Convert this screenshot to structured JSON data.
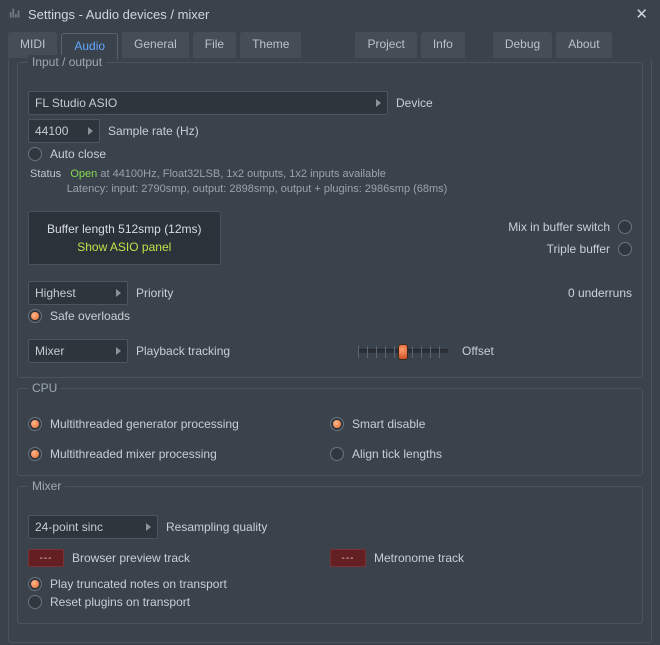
{
  "window": {
    "title": "Settings - Audio devices / mixer"
  },
  "tabs": {
    "midi": "MIDI",
    "audio": "Audio",
    "general": "General",
    "file": "File",
    "theme": "Theme",
    "project": "Project",
    "info": "Info",
    "debug": "Debug",
    "about": "About"
  },
  "io": {
    "legend": "Input / output",
    "device_value": "FL Studio ASIO",
    "device_label": "Device",
    "sample_rate_value": "44100",
    "sample_rate_label": "Sample rate (Hz)",
    "auto_close": "Auto close",
    "status_label": "Status",
    "status_open": "Open",
    "status_line1": "at 44100Hz, Float32LSB, 1x2 outputs, 1x2 inputs available",
    "status_line2": "Latency: input: 2790smp, output: 2898smp, output + plugins: 2986smp (68ms)",
    "buffer_line1": "Buffer length 512smp (12ms)",
    "buffer_line2": "Show ASIO panel",
    "mix_in_buffer": "Mix in buffer switch",
    "triple_buffer": "Triple buffer",
    "priority_value": "Highest",
    "priority_label": "Priority",
    "underruns": "0 underruns",
    "safe_overloads": "Safe overloads",
    "tracking_value": "Mixer",
    "tracking_label": "Playback tracking",
    "offset_label": "Offset"
  },
  "cpu": {
    "legend": "CPU",
    "mt_gen": "Multithreaded generator processing",
    "mt_mix": "Multithreaded mixer processing",
    "smart_disable": "Smart disable",
    "align_ticks": "Align tick lengths"
  },
  "mixer": {
    "legend": "Mixer",
    "resampling_value": "24-point sinc",
    "resampling_label": "Resampling quality",
    "browser_track": "Browser preview track",
    "metronome_track": "Metronome track",
    "mini_value": "---",
    "play_truncated": "Play truncated notes on transport",
    "reset_plugins": "Reset plugins on transport"
  }
}
